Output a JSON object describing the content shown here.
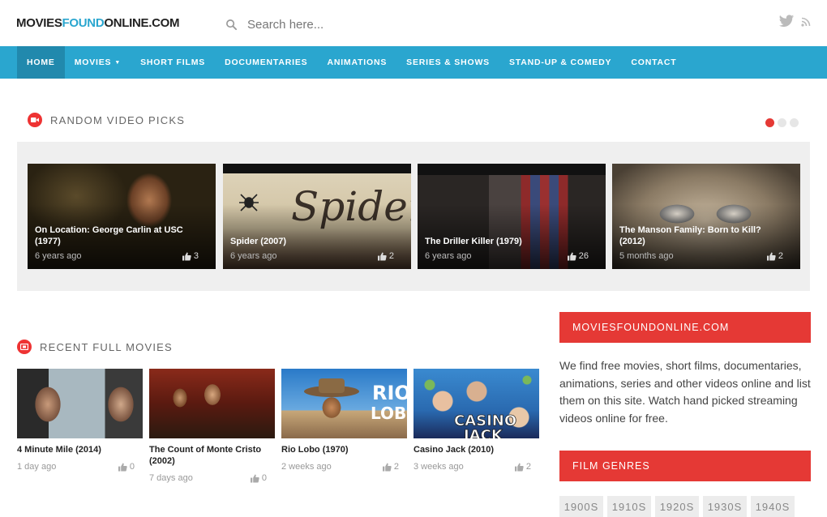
{
  "header": {
    "logo_part1": "MOVIES",
    "logo_part2": "FOUND",
    "logo_part3": "ONLINE.COM",
    "search_placeholder": "Search here..."
  },
  "nav": {
    "items": [
      {
        "label": "HOME"
      },
      {
        "label": "MOVIES"
      },
      {
        "label": "SHORT FILMS"
      },
      {
        "label": "DOCUMENTARIES"
      },
      {
        "label": "ANIMATIONS"
      },
      {
        "label": "SERIES & SHOWS"
      },
      {
        "label": "STAND-UP & COMEDY"
      },
      {
        "label": "CONTACT"
      }
    ]
  },
  "random_picks": {
    "heading": "RANDOM VIDEO PICKS",
    "slides": [
      {
        "title": "On Location: George Carlin at USC (1977)",
        "age": "6 years ago",
        "likes": "3"
      },
      {
        "title": "Spider (2007)",
        "age": "6 years ago",
        "likes": "2"
      },
      {
        "title": "The Driller Killer (1979)",
        "age": "6 years ago",
        "likes": "26"
      },
      {
        "title": "The Manson Family: Born to Kill? (2012)",
        "age": "5 months ago",
        "likes": "2"
      }
    ]
  },
  "recent_movies": {
    "heading": "RECENT FULL MOVIES",
    "items": [
      {
        "title": "4 Minute Mile (2014)",
        "age": "1 day ago",
        "likes": "0"
      },
      {
        "title": "The Count of Monte Cristo (2002)",
        "age": "7 days ago",
        "likes": "0"
      },
      {
        "title": "Rio Lobo (1970)",
        "age": "2 weeks ago",
        "likes": "2"
      },
      {
        "title": "Casino Jack (2010)",
        "age": "3 weeks ago",
        "likes": "2"
      }
    ]
  },
  "poster_text": {
    "spider": "Spider",
    "rio": "RIO",
    "lobo": "LOBO",
    "casino": "CASINO",
    "jack": "JACK"
  },
  "sidebar": {
    "about_heading": "MOVIESFOUNDONLINE.COM",
    "about_text": "We find free movies, short films, documentaries, animations, series and other videos online and list them on this site. Watch hand picked streaming videos online for free.",
    "genres_heading": "FILM GENRES",
    "genres": [
      "1900S",
      "1910S",
      "1920S",
      "1930S",
      "1940S"
    ]
  },
  "colors": {
    "brand_blue": "#2aa6cf",
    "accent_red": "#e53935"
  }
}
